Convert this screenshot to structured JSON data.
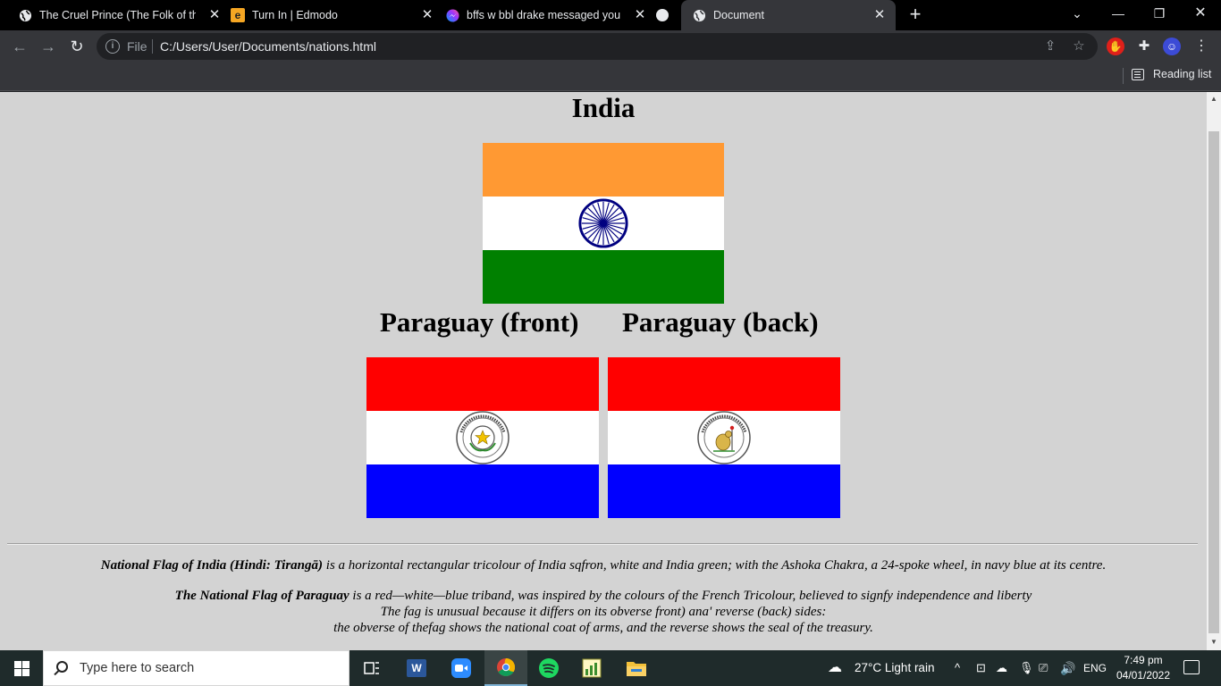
{
  "browser": {
    "tabs": [
      {
        "title": "The Cruel Prince (The Folk of the",
        "icon": "globe-icon"
      },
      {
        "title": "Turn In | Edmodo",
        "icon": "edmodo-icon"
      },
      {
        "title": "bffs w bbl drake messaged you",
        "icon": "messenger-icon"
      },
      {
        "title": "",
        "icon": "circle-icon"
      },
      {
        "title": "Document",
        "icon": "globe-icon",
        "active": true
      }
    ],
    "address": {
      "scheme": "File",
      "url": "C:/Users/User/Documents/nations.html"
    },
    "reading_list": "Reading list"
  },
  "page": {
    "india_heading": "India",
    "paraguay_front_heading": "Paraguay (front)",
    "paraguay_back_heading": "Paraguay (back)",
    "flag_colors": {
      "india_saffron": "#ff9933",
      "india_white": "#ffffff",
      "india_green": "#008000",
      "chakra_navy": "#000080",
      "paraguay_red": "#ff0000",
      "paraguay_white": "#ffffff",
      "paraguay_blue": "#0000ff"
    },
    "india_desc": {
      "bold": "National Flag of India (Hindi: Tirangā)",
      "text": " is a horizontal rectangular tricolour of India sqfron, white and India green; with the Ashoka Chakra, a 24-spoke wheel, in navy blue at its centre."
    },
    "paraguay_desc": {
      "bold": "The National Flag of Paraguay",
      "line1": " is a red—white—blue triband, was inspired by the colours of the French Tricolour, believed to signfy independence and liberty",
      "line2": "The fag is unusual because it differs on its obverse front) ana' reverse (back) sides:",
      "line3": "the obverse of thefag shows the national coat of arms, and the reverse shows the seal of the treasury."
    }
  },
  "taskbar": {
    "search_placeholder": "Type here to search",
    "weather": "27°C  Light rain",
    "language": "ENG",
    "time": "7:49 pm",
    "date": "04/01/2022"
  }
}
